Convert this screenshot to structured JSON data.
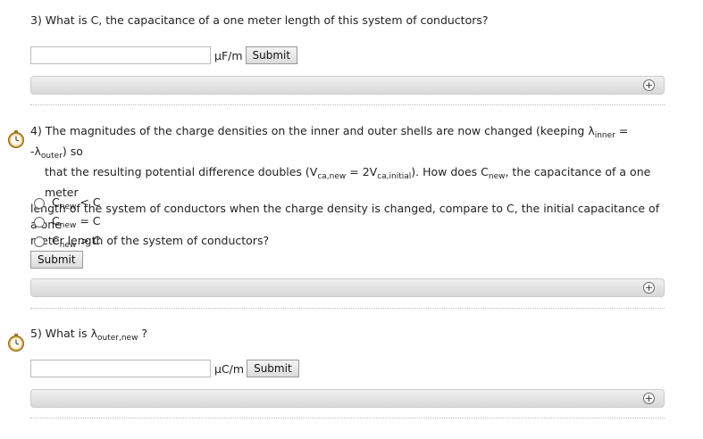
{
  "q3": {
    "text": "3) What is C, the capacitance of a one meter length of this system of conductors?",
    "unit": "μF/m",
    "submit": "Submit",
    "expand": "+"
  },
  "q4": {
    "p1": "4) The magnitudes of the charge densities on the inner and outer shells are now changed (keeping λ",
    "s1": "inner",
    "p2": " = -λ",
    "s2": "outer",
    "p3": ") so",
    "p4": "that the resulting potential difference doubles (V",
    "s3": "ca,new",
    "p5": " = 2V",
    "s4": "ca,initial",
    "p6": "). How does C",
    "s5": "new",
    "p7": ", the capacitance of a one meter",
    "line3": "length of the system of conductors when the charge density is changed, compare to C, the initial capacitance of a one",
    "line4": "meter length of the system of conductors?",
    "options": [
      {
        "base": "C",
        "sub": "new",
        "rest": " < C"
      },
      {
        "base": "C",
        "sub": "new",
        "rest": " = C"
      },
      {
        "base": "C",
        "sub": "new",
        "rest": " > C"
      }
    ],
    "submit": "Submit",
    "expand": "+"
  },
  "q5": {
    "p1": "5) What is λ",
    "s1": "outer,new",
    "p2": " ?",
    "unit": "μC/m",
    "submit": "Submit",
    "expand": "+"
  }
}
